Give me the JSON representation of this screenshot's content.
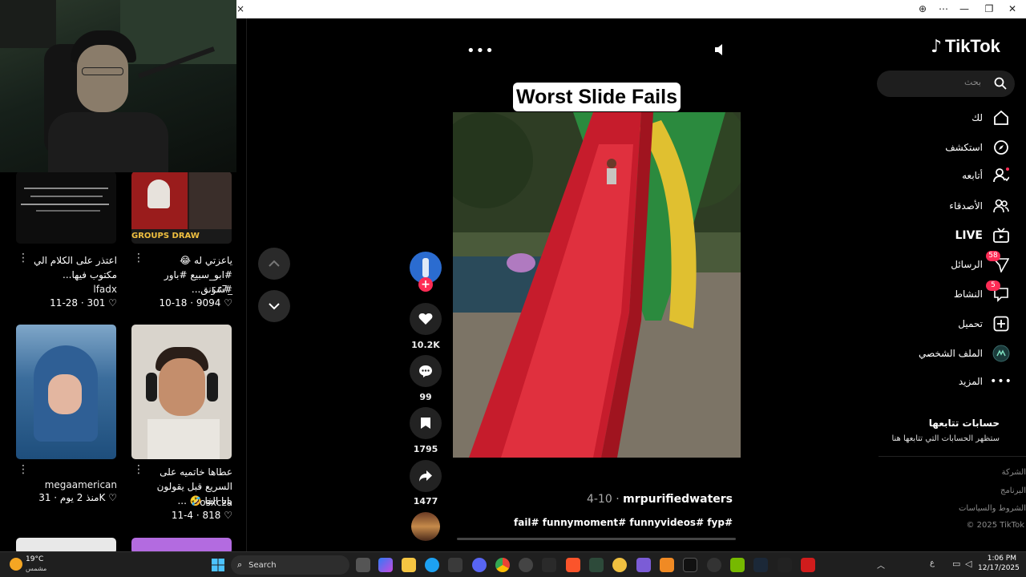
{
  "window": {
    "close_left": "×",
    "buttons": [
      "⊕",
      "⋯",
      "—",
      "❐",
      "✕"
    ]
  },
  "left_panel": {
    "videos": [
      {
        "caption": "اعتذر على الكلام الي مكتوب فيها...",
        "author": "lfadx",
        "likes": "301",
        "date": "11-28"
      },
      {
        "caption": "ياعزتي له 😂 #ابو_سبيع #باور #شونق...",
        "author": "r.r7_",
        "likes": "9094",
        "date": "10-18"
      },
      {
        "caption": "",
        "author": "megaamerican",
        "likes": "31K",
        "date": "منذ 2 يوم"
      },
      {
        "caption": "عطاها خاتميه على السريع قبل يقولون بابا الفا 🤣 ...",
        "author": "osxcza",
        "likes": "818",
        "date": "11-4"
      }
    ],
    "thumb_text_groups": "GROUPS DRAW"
  },
  "video": {
    "title": "Worst Slide Fails",
    "likes": "10.2K",
    "comments": "99",
    "saves": "1795",
    "shares": "1477",
    "author": "mrpurifiedwaters",
    "date": "4-10",
    "tags": "fail# funnymoment# funnyvideos# fyp#"
  },
  "sidebar": {
    "logo": "TikTok",
    "search_placeholder": "بحث",
    "items": [
      {
        "label": "لك",
        "icon": "home-icon"
      },
      {
        "label": "استكشف",
        "icon": "compass-icon"
      },
      {
        "label": "أتابعه",
        "icon": "user-follow-icon"
      },
      {
        "label": "الأصدقاء",
        "icon": "friends-icon"
      },
      {
        "label": "LIVE",
        "icon": "live-icon"
      },
      {
        "label": "الرسائل",
        "icon": "send-icon",
        "badge": "58"
      },
      {
        "label": "النشاط",
        "icon": "activity-icon",
        "badge": "5"
      },
      {
        "label": "تحميل",
        "icon": "upload-icon"
      },
      {
        "label": "الملف الشخصي",
        "icon": "profile-icon"
      },
      {
        "label": "المزيد",
        "icon": "more-icon"
      }
    ],
    "following_title": "حسابات تتابعها",
    "following_sub": "ستظهر الحسابات التي تتابعها هنا",
    "footer": [
      "الشركة",
      "البرنامج",
      "الشروط والسياسات",
      "© 2025 TikTok"
    ]
  },
  "taskbar": {
    "weather_temp": "19°C",
    "weather_desc": "مشمس",
    "search_label": "Search",
    "lang": "ع",
    "time": "1:06 PM",
    "date": "12/17/2025"
  },
  "colors": {
    "accent": "#fe2c55",
    "brand": "#ffffff"
  }
}
